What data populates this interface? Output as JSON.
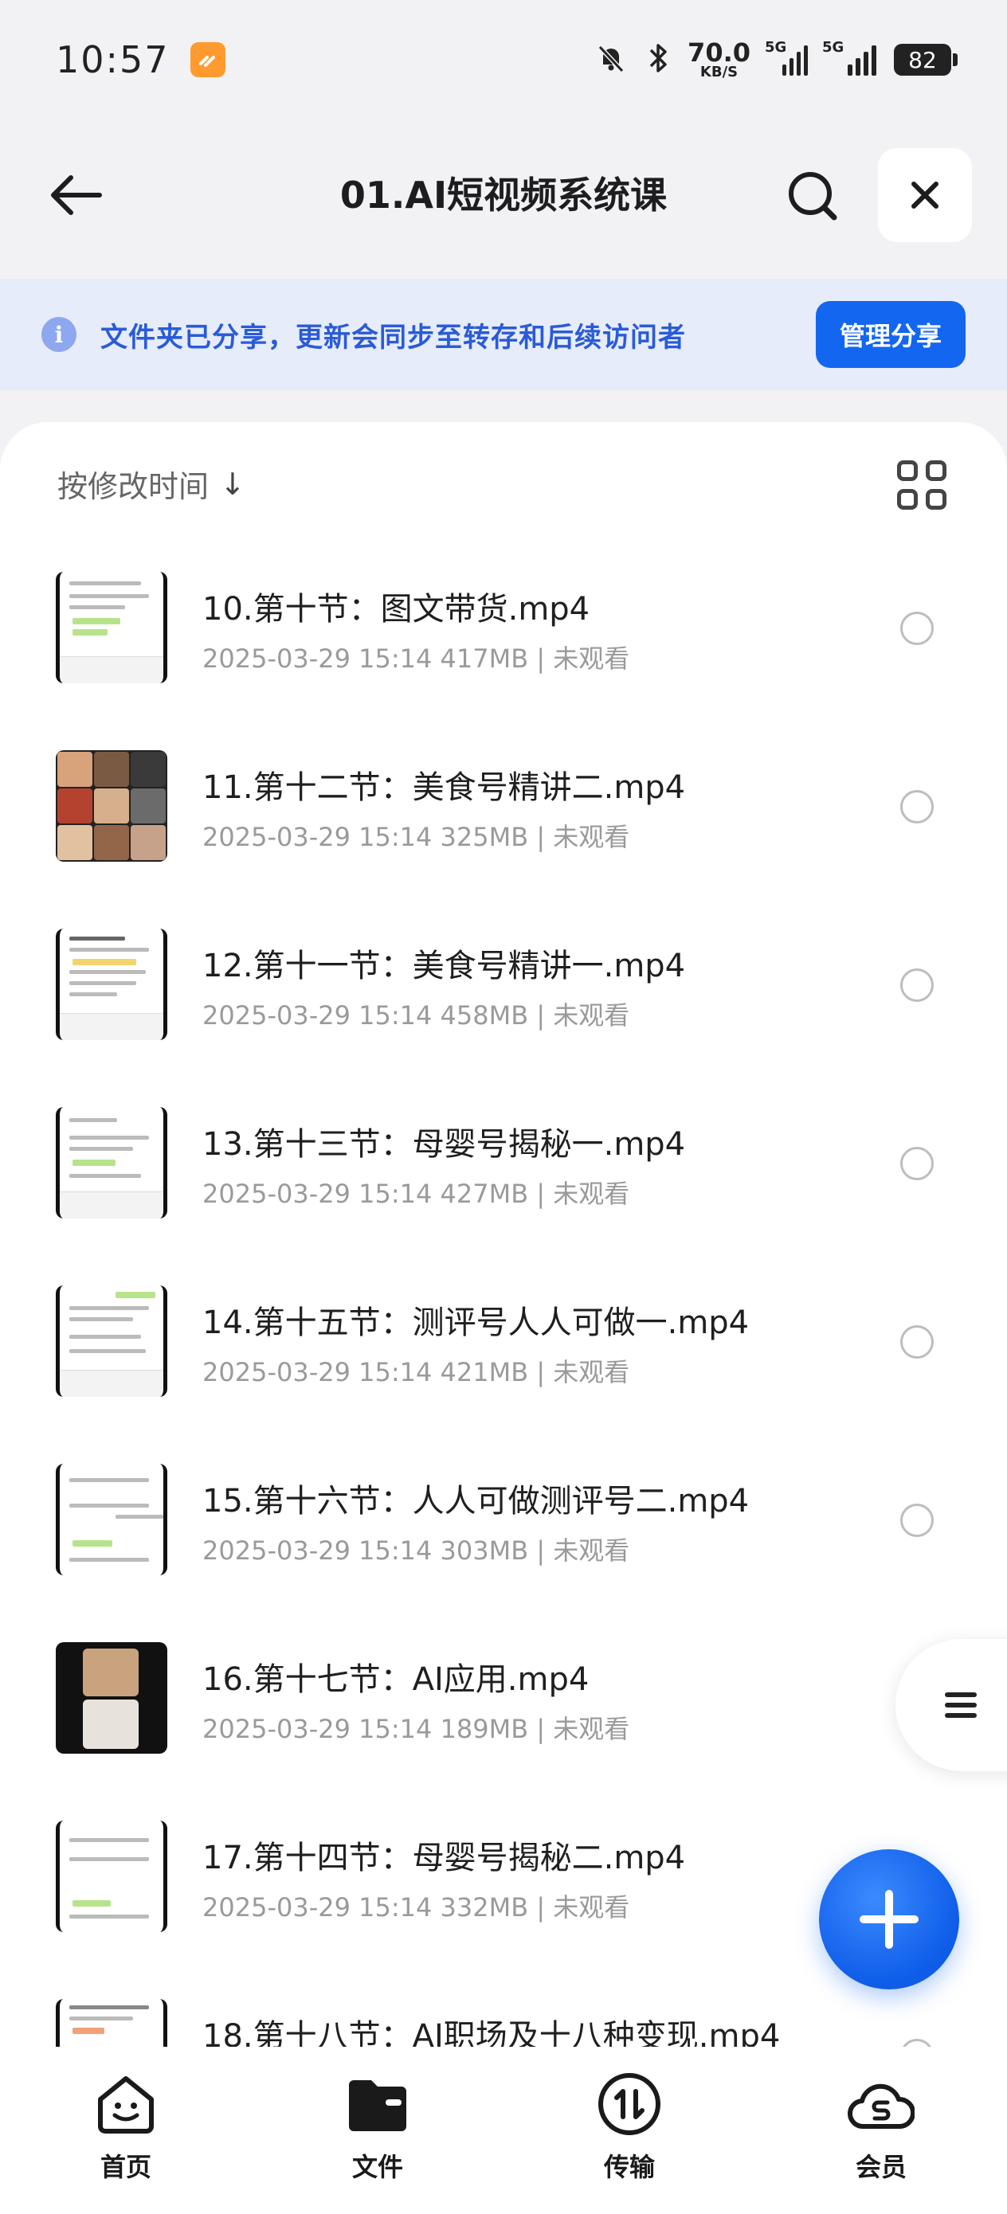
{
  "status_bar": {
    "time": "10:57",
    "net_speed_value": "70.0",
    "net_speed_unit": "KB/S",
    "signal1_label": "5G",
    "signal2_label": "5G",
    "battery": "82"
  },
  "header": {
    "title": "01.AI短视频系统课"
  },
  "share_banner": {
    "info_glyph": "i",
    "text": "文件夹已分享，更新会同步至转存和后续访问者",
    "button_label": "管理分享"
  },
  "sort": {
    "label": "按修改时间",
    "arrow": "↓"
  },
  "files": [
    {
      "name": "10.第十节：图文带货.mp4",
      "meta": "2025-03-29 15:14 417MB | 未观看"
    },
    {
      "name": "11.第十二节：美食号精讲二.mp4",
      "meta": "2025-03-29 15:14 325MB | 未观看"
    },
    {
      "name": "12.第十一节：美食号精讲一.mp4",
      "meta": "2025-03-29 15:14 458MB | 未观看"
    },
    {
      "name": "13.第十三节：母婴号揭秘一.mp4",
      "meta": "2025-03-29 15:14 427MB | 未观看"
    },
    {
      "name": "14.第十五节：测评号人人可做一.mp4",
      "meta": "2025-03-29 15:14 421MB | 未观看"
    },
    {
      "name": "15.第十六节：人人可做测评号二.mp4",
      "meta": "2025-03-29 15:14 303MB | 未观看"
    },
    {
      "name": "16.第十七节：AI应用.mp4",
      "meta": "2025-03-29 15:14 189MB | 未观看"
    },
    {
      "name": "17.第十四节：母婴号揭秘二.mp4",
      "meta": "2025-03-29 15:14 332MB | 未观看"
    },
    {
      "name": "18.第十八节：AI职场及十八种变现.mp4",
      "meta": ""
    }
  ],
  "bottom_nav": {
    "home": "首页",
    "files": "文件",
    "transfer": "传输",
    "vip": "会员"
  },
  "colors": {
    "accent": "#1366f0",
    "banner_bg": "#e6ecfa",
    "banner_text": "#2a5bd7",
    "app_badge": "#ff9a2e"
  },
  "icons": [
    "mute-bell-icon",
    "bluetooth-icon",
    "back-arrow-icon",
    "search-icon",
    "close-icon",
    "info-icon",
    "grid-view-icon",
    "menu-icon",
    "plus-icon",
    "home-icon",
    "folder-icon",
    "transfer-icon",
    "vip-cloud-icon"
  ]
}
